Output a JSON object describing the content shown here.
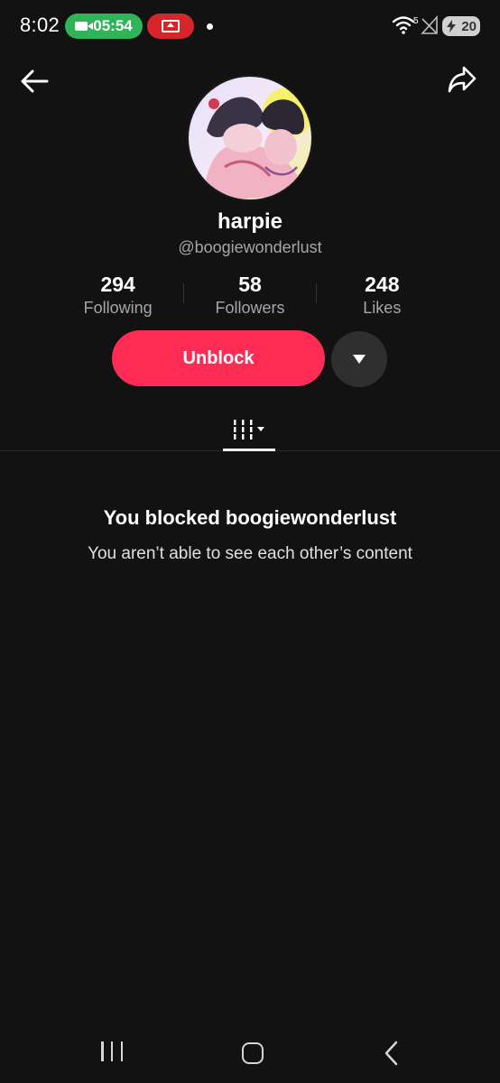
{
  "status_bar": {
    "time": "8:02",
    "call_timer": "05:54",
    "battery_level": "20",
    "network_type": "5"
  },
  "profile": {
    "display_name": "harpie",
    "username": "@boogiewonderlust",
    "stats": [
      {
        "value": "294",
        "label": "Following"
      },
      {
        "value": "58",
        "label": "Followers"
      },
      {
        "value": "248",
        "label": "Likes"
      }
    ]
  },
  "actions": {
    "unblock_label": "Unblock"
  },
  "blocked_message": {
    "title": "You blocked boogiewonderlust",
    "subtitle": "You aren’t able to see each other’s content"
  },
  "colors": {
    "background": "#121212",
    "accent": "#fe2c55",
    "secondary_text": "#a6a6a6",
    "call_pill": "#2fb457",
    "cast_pill": "#d7262b"
  },
  "icons": {
    "back": "arrow-left-icon",
    "share": "share-arrow-icon",
    "more": "caret-down-icon",
    "videos_tab": "grid-bars-icon"
  }
}
